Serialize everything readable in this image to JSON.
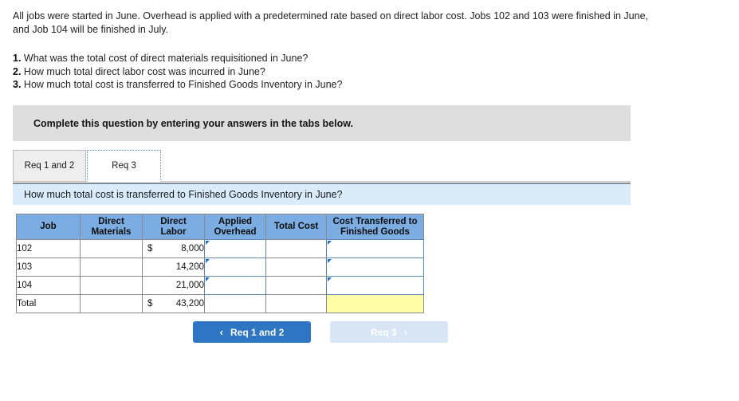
{
  "intro": {
    "paragraph": "All jobs were started in June. Overhead is applied with a predetermined rate based on direct labor cost. Jobs 102 and 103 were finished in June, and Job 104 will be finished in July."
  },
  "requirements": [
    {
      "num": "1.",
      "text": "What was the total cost of direct materials requisitioned in June?"
    },
    {
      "num": "2.",
      "text": "How much total direct labor cost was incurred in June?"
    },
    {
      "num": "3.",
      "text": "How much total cost is transferred to Finished Goods Inventory in June?"
    }
  ],
  "instruction_banner": {
    "text": "Complete this question by entering your answers in the tabs below."
  },
  "tabs": [
    {
      "label": "Req 1 and 2",
      "active": false
    },
    {
      "label": "Req 3",
      "active": true
    }
  ],
  "question_banner": {
    "text": "How much total cost is transferred to Finished Goods Inventory in June?"
  },
  "table": {
    "headers": [
      "Job",
      "Direct Materials",
      "Direct Labor",
      "Applied Overhead",
      "Total Cost",
      "Cost Transferred to Finished Goods"
    ],
    "header_lines": [
      [
        "Job"
      ],
      [
        "Direct",
        "Materials"
      ],
      [
        "Direct",
        "Labor"
      ],
      [
        "Applied",
        "Overhead"
      ],
      [
        "Total Cost"
      ],
      [
        "Cost Transferred to",
        "Finished Goods"
      ]
    ],
    "rows": [
      {
        "job": "102",
        "direct_materials": "",
        "direct_labor_sign": "$",
        "direct_labor": "8,000",
        "applied_overhead": "",
        "total_cost": "",
        "cost_transferred": ""
      },
      {
        "job": "103",
        "direct_materials": "",
        "direct_labor_sign": "",
        "direct_labor": "14,200",
        "applied_overhead": "",
        "total_cost": "",
        "cost_transferred": ""
      },
      {
        "job": "104",
        "direct_materials": "",
        "direct_labor_sign": "",
        "direct_labor": "21,000",
        "applied_overhead": "",
        "total_cost": "",
        "cost_transferred": ""
      }
    ],
    "total_row": {
      "job": "Total",
      "direct_materials": "",
      "direct_labor_sign": "$",
      "direct_labor": "43,200",
      "applied_overhead": "",
      "total_cost": "",
      "cost_transferred": ""
    }
  },
  "nav": {
    "prev_label": "Req 1 and 2",
    "prev_chevron": "‹",
    "next_label": "Req 3",
    "next_chevron": "›"
  },
  "colors": {
    "header_blue": "#7cade2",
    "question_banner_blue": "#daecfa",
    "instruction_gray": "#dedede",
    "input_border_blue": "#5b87b5",
    "highlight_yellow": "#ffffa8",
    "button_blue": "#2e75c4",
    "button_disabled_blue": "#d7e5f5"
  }
}
